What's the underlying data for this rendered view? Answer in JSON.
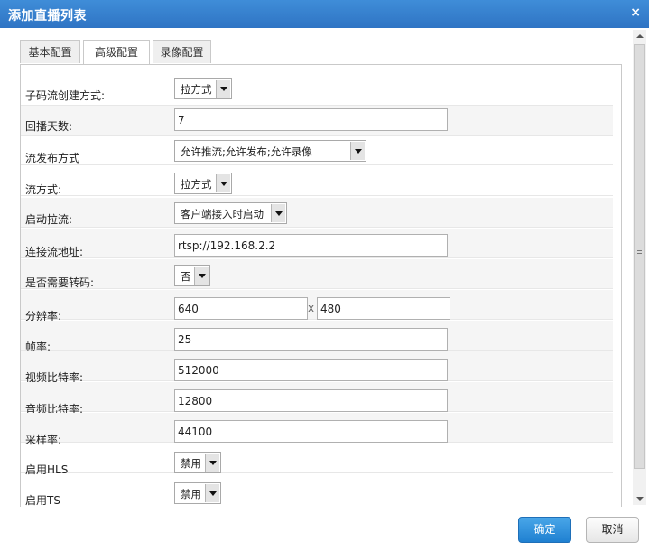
{
  "dialog": {
    "title": "添加直播列表",
    "close_glyph": "×"
  },
  "tabs": [
    {
      "label": "基本配置",
      "active": false
    },
    {
      "label": "高级配置",
      "active": true
    },
    {
      "label": "录像配置",
      "active": false
    }
  ],
  "form": {
    "substream_mode": {
      "label": "子码流创建方式:",
      "value": "拉方式"
    },
    "playback_days": {
      "label": "回播天数:",
      "value": "7"
    },
    "publish_mode": {
      "label": "流发布方式",
      "value": "允许推流;允许发布;允许录像"
    },
    "stream_mode": {
      "label": "流方式:",
      "value": "拉方式"
    },
    "start_pull": {
      "label": "启动拉流:",
      "value": "客户端接入时启动"
    },
    "stream_url": {
      "label": "连接流地址:",
      "value": "rtsp://192.168.2.2"
    },
    "transcode": {
      "label": "是否需要转码:",
      "value": "否"
    },
    "resolution": {
      "label": "分辨率:",
      "width": "640",
      "height": "480",
      "separator": "x"
    },
    "framerate": {
      "label": "帧率:",
      "value": "25"
    },
    "video_bitrate": {
      "label": "视频比特率:",
      "value": "512000"
    },
    "audio_bitrate": {
      "label": "音频比特率:",
      "value": "12800"
    },
    "sample_rate": {
      "label": "采样率:",
      "value": "44100"
    },
    "hls": {
      "label": "启用HLS",
      "value": "禁用"
    },
    "ts": {
      "label": "启用TS",
      "value": "禁用"
    }
  },
  "buttons": {
    "confirm": "确定",
    "cancel": "取消"
  },
  "colors": {
    "titlebar": "#2f74c4",
    "primary_button": "#1f80d1"
  }
}
